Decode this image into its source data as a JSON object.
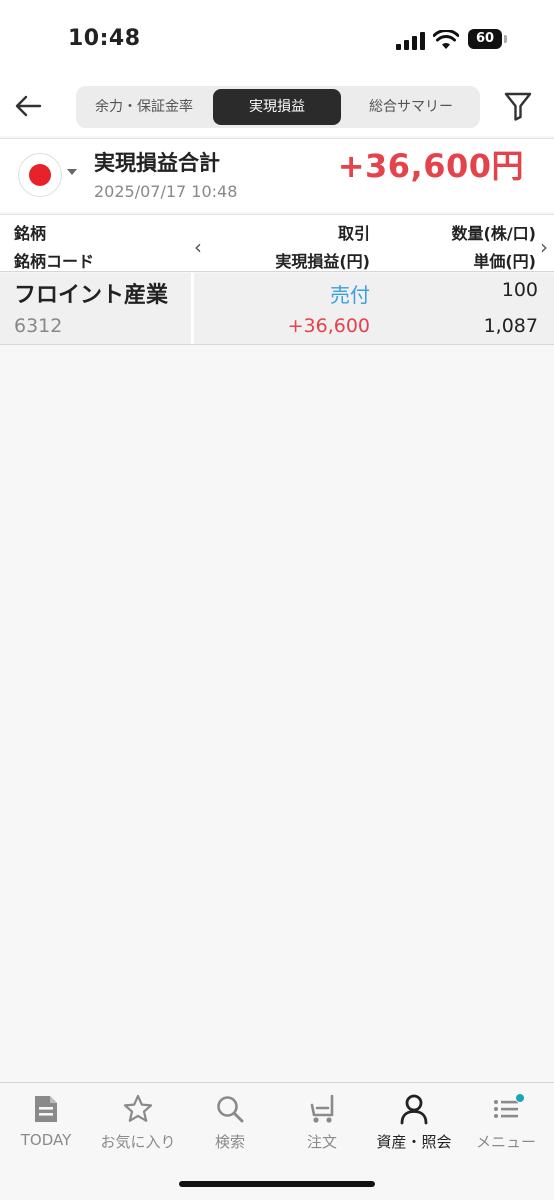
{
  "status_bar": {
    "time": "10:48",
    "battery": "60"
  },
  "nav": {
    "tabs": [
      {
        "label": "余力・保証金率"
      },
      {
        "label": "実現損益"
      },
      {
        "label": "総合サマリー"
      }
    ]
  },
  "summary": {
    "title": "実現損益合計",
    "datetime": "2025/07/17 10:48",
    "total": "+36,600円"
  },
  "table": {
    "headers": {
      "name": "銘柄",
      "code": "銘柄コード",
      "trade": "取引",
      "pnl": "実現損益(円)",
      "qty": "数量(株/口)",
      "price": "単価(円)"
    },
    "rows": [
      {
        "name": "フロイント産業",
        "code": "6312",
        "side": "売付",
        "pnl": "+36,600",
        "qty": "100",
        "price": "1,087"
      }
    ]
  },
  "tabbar": {
    "items": [
      {
        "label": "TODAY",
        "icon": "document-icon"
      },
      {
        "label": "お気に入り",
        "icon": "star-icon"
      },
      {
        "label": "検索",
        "icon": "search-icon"
      },
      {
        "label": "注文",
        "icon": "cart-icon"
      },
      {
        "label": "資産・照会",
        "icon": "person-icon"
      },
      {
        "label": "メニュー",
        "icon": "menu-list-icon"
      }
    ]
  },
  "colors": {
    "profit": "#e4434b",
    "sell": "#3aa0e0",
    "active_segment": "#2b2b2b",
    "notification": "#1aa6b7"
  }
}
